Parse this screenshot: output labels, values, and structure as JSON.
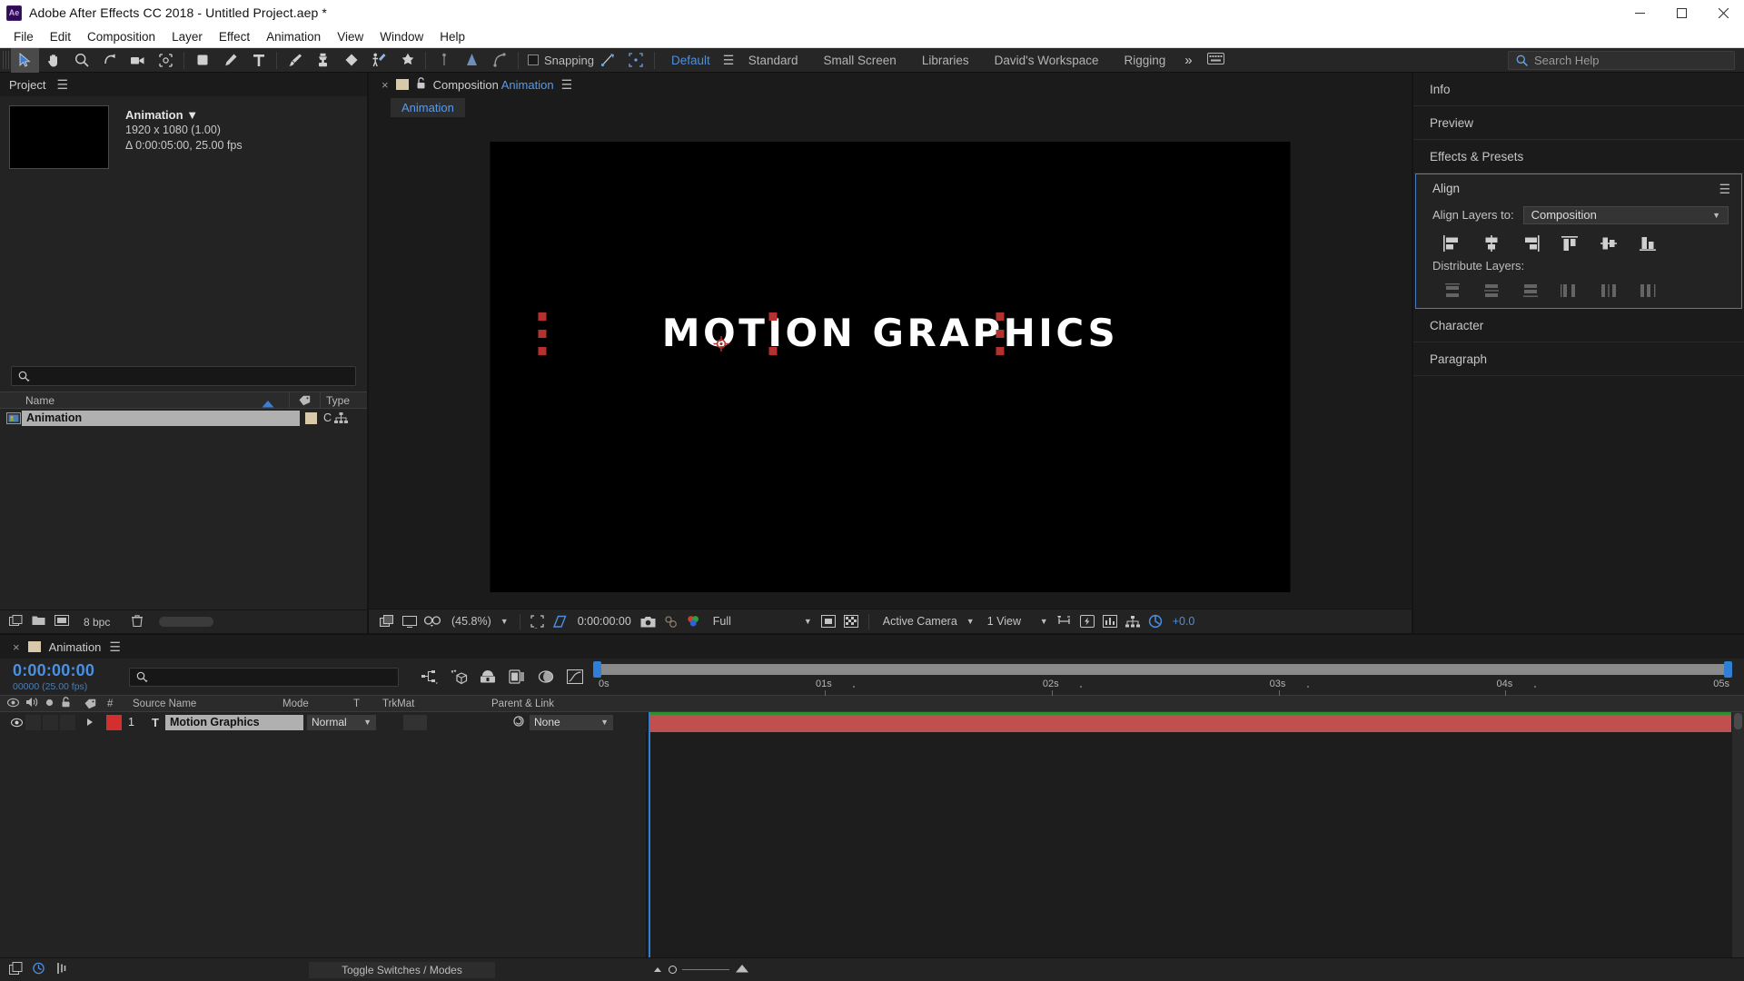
{
  "window": {
    "app_icon": "ae-logo-icon",
    "title": "Adobe After Effects CC 2018 - Untitled Project.aep *",
    "controls": [
      "minimize",
      "maximize",
      "close"
    ]
  },
  "menubar": {
    "items": [
      "File",
      "Edit",
      "Composition",
      "Layer",
      "Effect",
      "Animation",
      "View",
      "Window",
      "Help"
    ]
  },
  "toolbar": {
    "tools": [
      {
        "name": "selection-tool",
        "active": true
      },
      {
        "name": "hand-tool",
        "active": false
      },
      {
        "name": "zoom-tool",
        "active": false
      },
      {
        "name": "rotation-tool",
        "active": false
      },
      {
        "name": "camera-tool",
        "active": false
      },
      {
        "name": "pan-behind-tool",
        "active": false
      },
      {
        "name": "shape-tool",
        "active": false
      },
      {
        "name": "pen-tool",
        "active": false
      },
      {
        "name": "type-tool",
        "active": false
      },
      {
        "name": "brush-tool",
        "active": false
      },
      {
        "name": "clone-stamp-tool",
        "active": false
      },
      {
        "name": "eraser-tool",
        "active": false
      },
      {
        "name": "roto-brush-tool",
        "active": false
      },
      {
        "name": "puppet-pin-tool",
        "active": false
      }
    ],
    "right_tools": [
      {
        "name": "puppet-starch-tool"
      },
      {
        "name": "puppet-overlap-tool"
      },
      {
        "name": "puppet-bend-tool"
      }
    ],
    "snapping_label": "Snapping",
    "snapping_checked": false,
    "workspaces": [
      {
        "label": "Default",
        "selected": true
      },
      {
        "label": "Standard",
        "selected": false
      },
      {
        "label": "Small Screen",
        "selected": false
      },
      {
        "label": "Libraries",
        "selected": false
      },
      {
        "label": "David's Workspace",
        "selected": false
      },
      {
        "label": "Rigging",
        "selected": false
      }
    ],
    "overflow_label": "»",
    "search_placeholder": "Search Help"
  },
  "project": {
    "tab_label": "Project",
    "menu_icon": "panel-menu-icon",
    "item": {
      "name": "Animation",
      "resolution": "1920 x 1080 (1.00)",
      "duration": "Δ 0:00:05:00, 25.00 fps"
    },
    "search_placeholder": "",
    "columns": [
      "Name",
      "Type"
    ],
    "rows": [
      {
        "name": "Animation",
        "label_color": "#d8c9ab",
        "type": "C"
      }
    ],
    "footer": {
      "bit_depth": "8 bpc"
    }
  },
  "composition": {
    "tab_close": "×",
    "label_prefix": "Composition",
    "label_name": "Animation",
    "chip_label": "Animation",
    "canvas_text": "MOTION GRAPHICS",
    "bottom_bar": {
      "magnification": "(45.8%)",
      "current_time": "0:00:00:00",
      "resolution": "Full",
      "view_camera": "Active Camera",
      "view_layout": "1 View",
      "exposure": "+0.0"
    }
  },
  "right_panels": {
    "collapsed_top": [
      "Info",
      "Preview",
      "Effects & Presets"
    ],
    "align": {
      "title": "Align",
      "menu_icon": "panel-menu-icon",
      "align_to_label": "Align Layers to:",
      "align_to_value": "Composition",
      "align_buttons": [
        "align-left-icon",
        "align-horizontal-center-icon",
        "align-right-icon",
        "align-top-icon",
        "align-vertical-center-icon",
        "align-bottom-icon"
      ],
      "distribute_label": "Distribute Layers:",
      "distribute_buttons": [
        "distribute-top-icon",
        "distribute-vertical-center-icon",
        "distribute-bottom-icon",
        "distribute-left-icon",
        "distribute-horizontal-center-icon",
        "distribute-right-icon"
      ]
    },
    "collapsed_bottom": [
      "Character",
      "Paragraph"
    ]
  },
  "timeline": {
    "tab_close": "×",
    "tab_label": "Animation",
    "menu_icon": "panel-menu-icon",
    "current_time": "0:00:00:00",
    "frame_info": "00000 (25.00 fps)",
    "search_placeholder": "",
    "tools": [
      "composition-mini-flowchart-icon",
      "draft-3d-icon",
      "hide-shy-layers-icon",
      "frame-blending-icon",
      "motion-blur-icon",
      "graph-editor-icon"
    ],
    "column_headers": {
      "av_features": [
        "video-icon",
        "audio-icon",
        "solo-icon",
        "lock-icon"
      ],
      "label": "label-icon",
      "number": "#",
      "source_name": "Source Name",
      "mode": "Mode",
      "t": "T",
      "trkmat": "TrkMat",
      "parent": "Parent & Link"
    },
    "layers": [
      {
        "index": "1",
        "type_icon": "T",
        "source_name": "Motion Graphics",
        "mode": "Normal",
        "trkmat": "",
        "parent": "None",
        "label_color": "#d32f2f",
        "visible": true
      }
    ],
    "ruler_ticks": [
      "0s",
      "01s",
      "02s",
      "03s",
      "04s",
      "05s"
    ],
    "footer": {
      "toggle_label": "Toggle Switches / Modes"
    }
  },
  "colors": {
    "accent_blue": "#4a90e2",
    "panel_bg": "#232323",
    "app_bg": "#1b1b1b",
    "layer_red": "#c0504d",
    "selection_red": "#b3322e",
    "label_tan": "#d8c9ab"
  }
}
